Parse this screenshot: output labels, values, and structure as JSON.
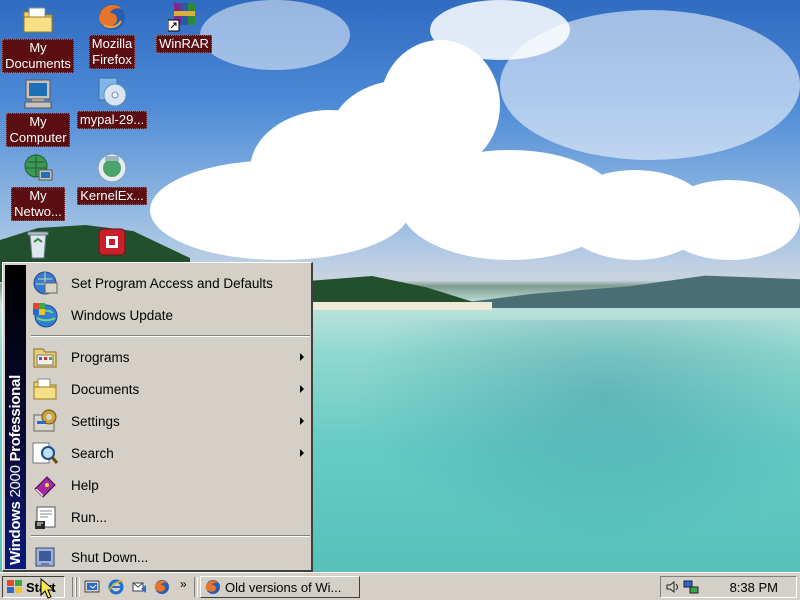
{
  "desktop": {
    "icons": [
      {
        "label": "My\nDocuments",
        "icon": "folder-documents-icon"
      },
      {
        "label": "Mozilla\nFirefox",
        "icon": "firefox-icon"
      },
      {
        "label": "WinRAR",
        "icon": "winrar-icon"
      },
      {
        "label": "My\nComputer",
        "icon": "computer-icon"
      },
      {
        "label": "mypal-29...",
        "icon": "installer-disc-icon"
      },
      {
        "label": "My\nNetwo...",
        "icon": "network-icon"
      },
      {
        "label": "KernelEx...",
        "icon": "kernelex-icon"
      }
    ]
  },
  "start_menu": {
    "banner": {
      "brand": "Windows",
      "version": "2000",
      "edition": "Professional"
    },
    "items": [
      {
        "label": "Set Program Access and Defaults",
        "icon": "program-access-icon",
        "submenu": false
      },
      {
        "label": "Windows Update",
        "icon": "windows-update-icon",
        "submenu": false
      },
      {
        "label": "Programs",
        "icon": "programs-icon",
        "submenu": true
      },
      {
        "label": "Documents",
        "icon": "documents-folder-icon",
        "submenu": true
      },
      {
        "label": "Settings",
        "icon": "settings-icon",
        "submenu": true
      },
      {
        "label": "Search",
        "icon": "search-icon",
        "submenu": true
      },
      {
        "label": "Help",
        "icon": "help-book-icon",
        "submenu": false
      },
      {
        "label": "Run...",
        "icon": "run-icon",
        "submenu": false
      },
      {
        "label": "Shut Down...",
        "icon": "shutdown-icon",
        "submenu": false
      }
    ]
  },
  "taskbar": {
    "start_label": "Start",
    "quick_launch": [
      "show-desktop-icon",
      "internet-explorer-icon",
      "outlook-express-icon",
      "firefox-icon"
    ],
    "chevron": "»",
    "tasks": [
      {
        "label": "Old versions of Wi...",
        "icon": "firefox-icon"
      }
    ],
    "tray": {
      "clock": "8:38 PM",
      "icons": [
        "volume-icon",
        "network-tray-icon"
      ]
    }
  }
}
